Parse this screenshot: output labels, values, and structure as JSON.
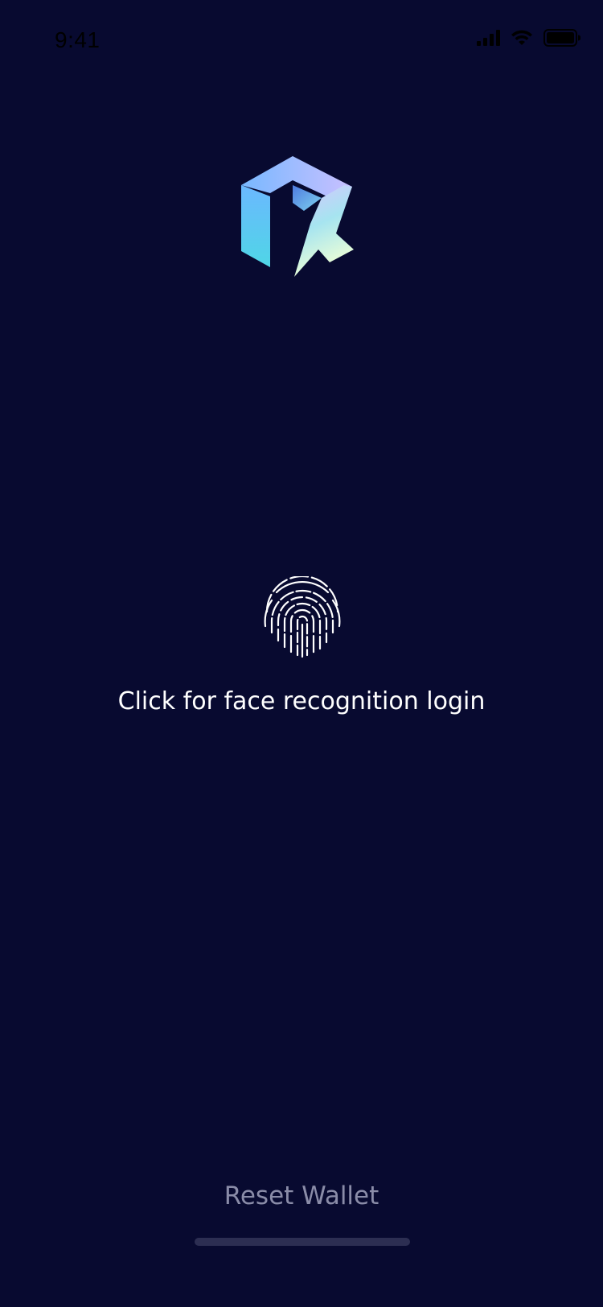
{
  "status_bar": {
    "time": "9:41",
    "icons": [
      "signal-icon",
      "wifi-icon",
      "battery-icon"
    ]
  },
  "logo": {
    "icon": "brand-logo-icon",
    "colors": [
      "#5AD1E8",
      "#9EA8FF",
      "#D6C8FF",
      "#E4FFD0"
    ]
  },
  "login": {
    "icon": "fingerprint-icon",
    "label": "Click for face recognition login"
  },
  "reset": {
    "label": "Reset Wallet"
  },
  "theme": {
    "background": "#080A30",
    "text": "#FFFFFF",
    "muted_text": "#8A8CA8"
  }
}
